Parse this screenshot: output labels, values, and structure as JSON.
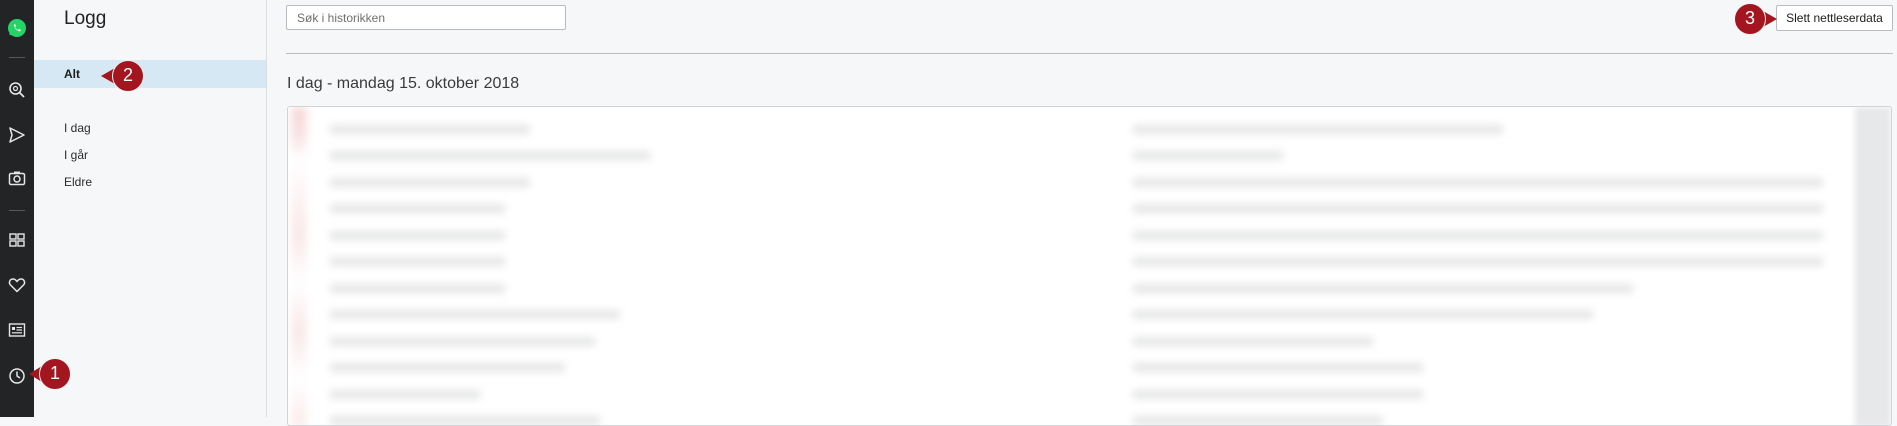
{
  "sidebar_rail": {
    "icons": [
      "whatsapp-icon",
      "search-icon",
      "send-icon",
      "camera-icon",
      "grid-icon",
      "heart-icon",
      "news-icon",
      "history-icon"
    ]
  },
  "panel": {
    "title": "Logg",
    "nav_all": "Alt",
    "nav_items": [
      "I dag",
      "I går",
      "Eldre"
    ]
  },
  "main": {
    "search_placeholder": "Søk i historikken",
    "clear_button": "Slett nettleserdata",
    "day_heading": "I dag - mandag 15. oktober 2018"
  },
  "callouts": [
    "1",
    "2",
    "3"
  ],
  "colors": {
    "rail_bg": "#222426",
    "whatsapp_green": "#25d366",
    "selected_nav": "#d6e8f4",
    "callout_red": "#a3161f"
  }
}
